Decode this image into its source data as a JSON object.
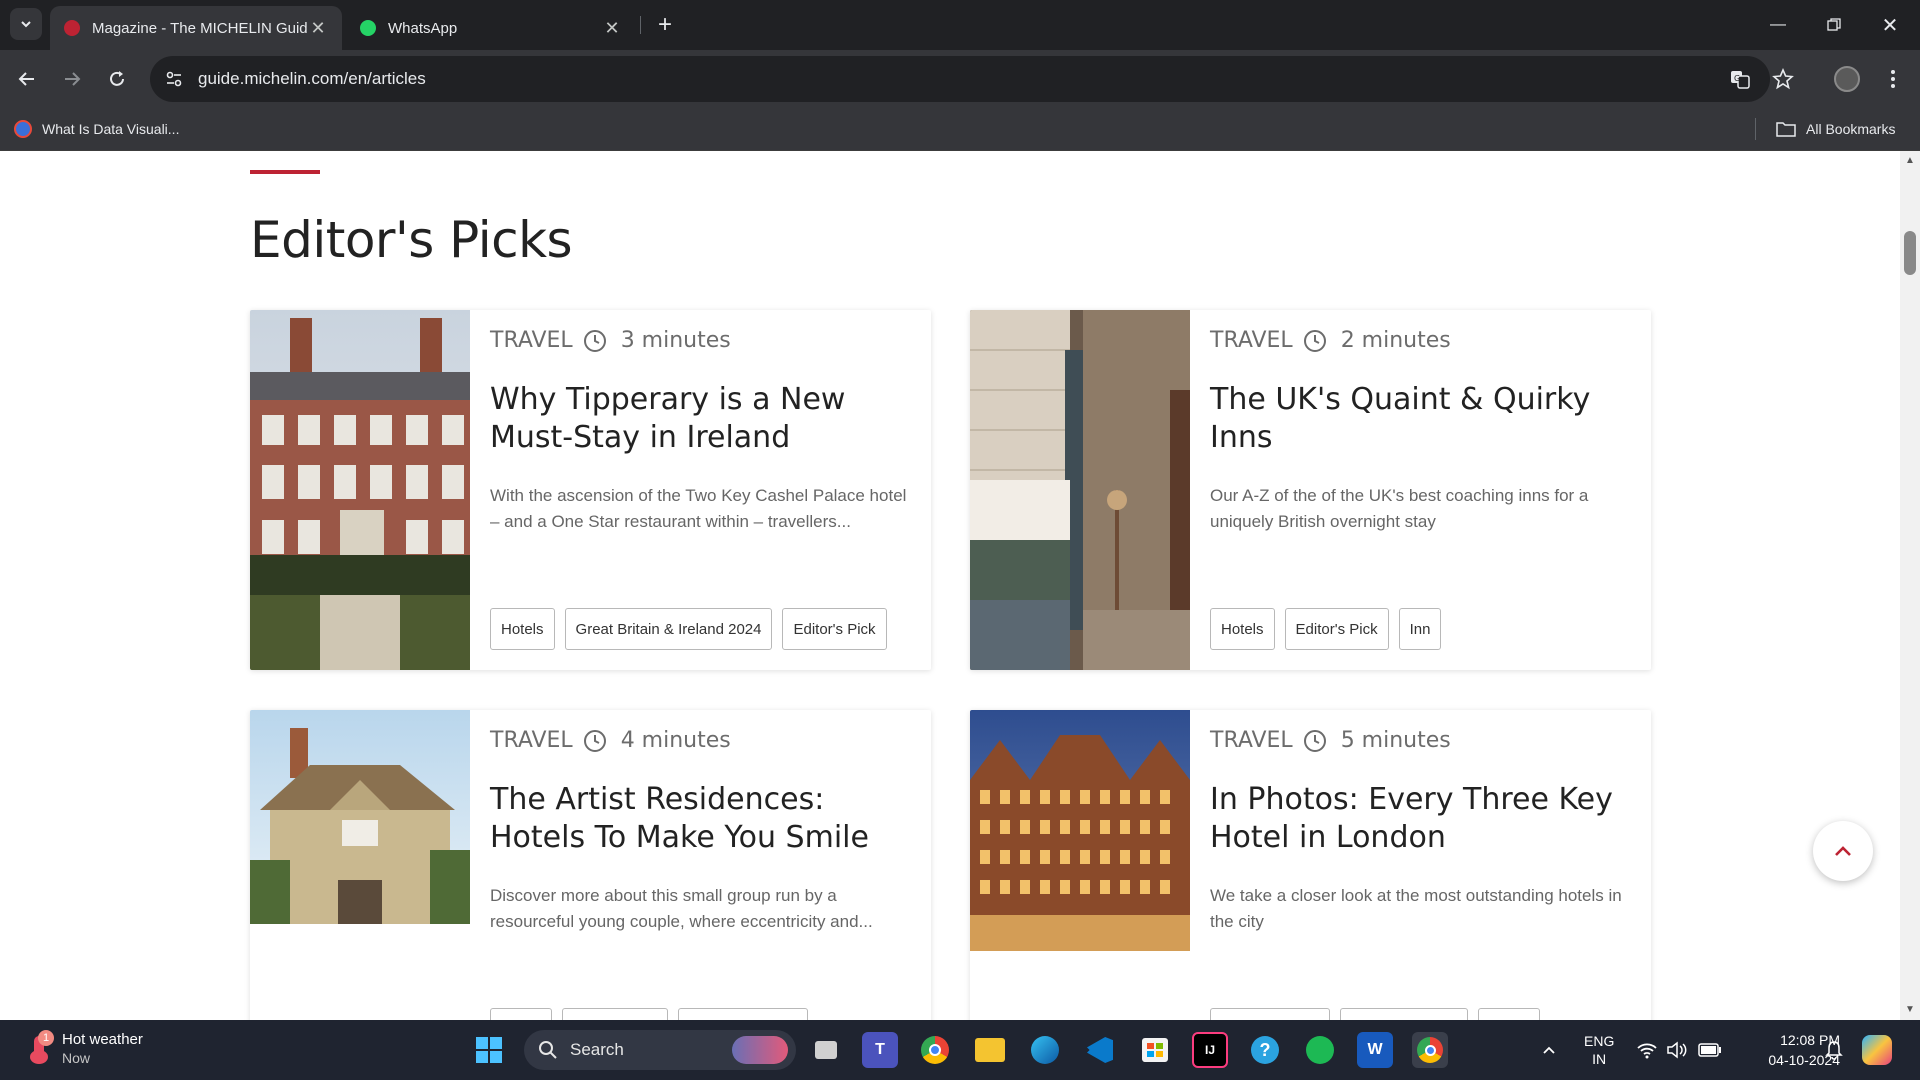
{
  "browser": {
    "tabs": [
      {
        "title": "Magazine - The MICHELIN Guide",
        "favicon": "michelin-icon",
        "active": true
      },
      {
        "title": "WhatsApp",
        "favicon": "whatsapp-icon",
        "active": false
      }
    ],
    "url": "guide.michelin.com/en/articles",
    "bookmarks": [
      {
        "label": "What Is Data Visuali..."
      }
    ],
    "all_bookmarks_label": "All Bookmarks"
  },
  "page": {
    "section_title": "Editor's Picks",
    "cards": [
      {
        "category": "TRAVEL",
        "read_time": "3 minutes",
        "title": "Why Tipperary is a New Must-Stay in Ireland",
        "description": "With the ascension of the Two Key Cashel Palace hotel – and a One Star restaurant within – travellers...",
        "tags": [
          "Hotels",
          "Great Britain & Ireland 2024",
          "Editor's Pick"
        ]
      },
      {
        "category": "TRAVEL",
        "read_time": "2 minutes",
        "title": "The UK's Quaint & Quirky Inns",
        "description": "Our A-Z of the of the UK's best coaching inns for a uniquely British overnight stay",
        "tags": [
          "Hotels",
          "Editor's Pick",
          "Inn"
        ]
      },
      {
        "category": "TRAVEL",
        "read_time": "4 minutes",
        "title": "The Artist Residences: Hotels To Make You Smile",
        "description": "Discover more about this small group run by a resourceful young couple, where eccentricity and...",
        "tags": [
          "",
          "",
          ""
        ]
      },
      {
        "category": "TRAVEL",
        "read_time": "5 minutes",
        "title": "In Photos: Every Three Key Hotel in London",
        "description": "We take a closer look at the most outstanding hotels in the city",
        "tags": [
          "",
          "",
          ""
        ]
      }
    ]
  },
  "taskbar": {
    "weather_title": "Hot weather",
    "weather_sub": "Now",
    "weather_badge": "1",
    "search_placeholder": "Search",
    "lang_top": "ENG",
    "lang_bottom": "IN",
    "time": "12:08 PM",
    "date": "04-10-2024"
  },
  "colors": {
    "accent": "#bd2333",
    "chrome_dark": "#202124",
    "chrome_mid": "#35363a",
    "taskbar": "#1f2430"
  }
}
